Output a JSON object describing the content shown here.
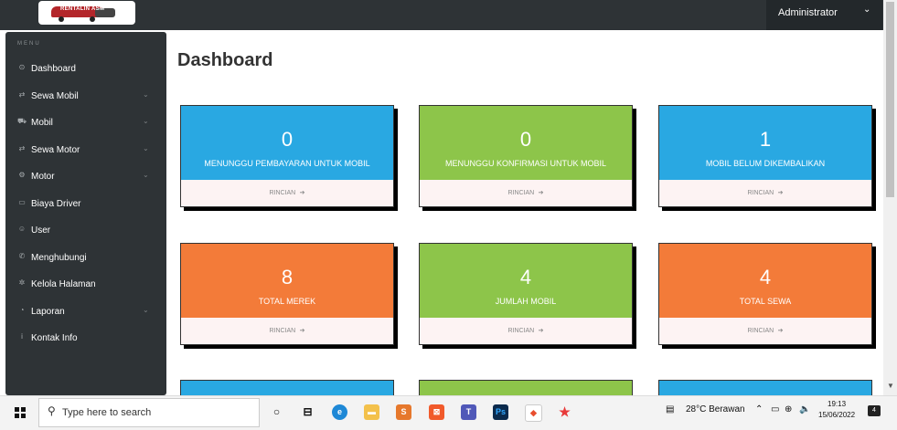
{
  "logo": {
    "text": "RENTALIN ASM"
  },
  "topbar": {
    "user": "Administrator",
    "chevron": "⌄"
  },
  "sidebar": {
    "heading": "MENU",
    "items": [
      {
        "label": "Dashboard",
        "icon": "dashboard-icon",
        "glyph": "⊙",
        "has_sub": false
      },
      {
        "label": "Sewa Mobil",
        "icon": "exchange-icon",
        "glyph": "⇄",
        "has_sub": true
      },
      {
        "label": "Mobil",
        "icon": "car-icon",
        "glyph": "⛟",
        "has_sub": true
      },
      {
        "label": "Sewa Motor",
        "icon": "exchange-icon",
        "glyph": "⇄",
        "has_sub": true
      },
      {
        "label": "Motor",
        "icon": "motorcycle-icon",
        "glyph": "⚙",
        "has_sub": true
      },
      {
        "label": "Biaya Driver",
        "icon": "money-icon",
        "glyph": "▭",
        "has_sub": false
      },
      {
        "label": "User",
        "icon": "users-icon",
        "glyph": "☺",
        "has_sub": false
      },
      {
        "label": "Menghubungi",
        "icon": "phone-icon",
        "glyph": "✆",
        "has_sub": false
      },
      {
        "label": "Kelola Halaman",
        "icon": "gear-icon",
        "glyph": "✲",
        "has_sub": false
      },
      {
        "label": "Laporan",
        "icon": "report-icon",
        "glyph": "◔",
        "has_sub": true
      },
      {
        "label": "Kontak Info",
        "icon": "info-icon",
        "glyph": "i",
        "has_sub": false
      }
    ],
    "sub_arrow": "⌄"
  },
  "main": {
    "title": "Dashboard",
    "cards": [
      {
        "value": "0",
        "label": "MENUNGGU PEMBAYARAN UNTUK MOBIL",
        "link": "RINCIAN",
        "color": "#29a8e2"
      },
      {
        "value": "0",
        "label": "MENUNGGU KONFIRMASI UNTUK MOBIL",
        "link": "RINCIAN",
        "color": "#8dc54a"
      },
      {
        "value": "1",
        "label": "MOBIL BELUM DIKEMBALIKAN",
        "link": "RINCIAN",
        "color": "#29a8e2"
      },
      {
        "value": "8",
        "label": "TOTAL MEREK",
        "link": "RINCIAN",
        "color": "#f37b39"
      },
      {
        "value": "4",
        "label": "JUMLAH MOBIL",
        "link": "RINCIAN",
        "color": "#8dc54a"
      },
      {
        "value": "4",
        "label": "TOTAL SEWA",
        "link": "RINCIAN",
        "color": "#f37b39"
      }
    ],
    "link_arrow": "➔"
  },
  "taskbar": {
    "search_placeholder": "Type here to search",
    "weather": "28°C  Berawan",
    "time": "19:13",
    "date": "15/06/2022",
    "notifications": "4"
  }
}
